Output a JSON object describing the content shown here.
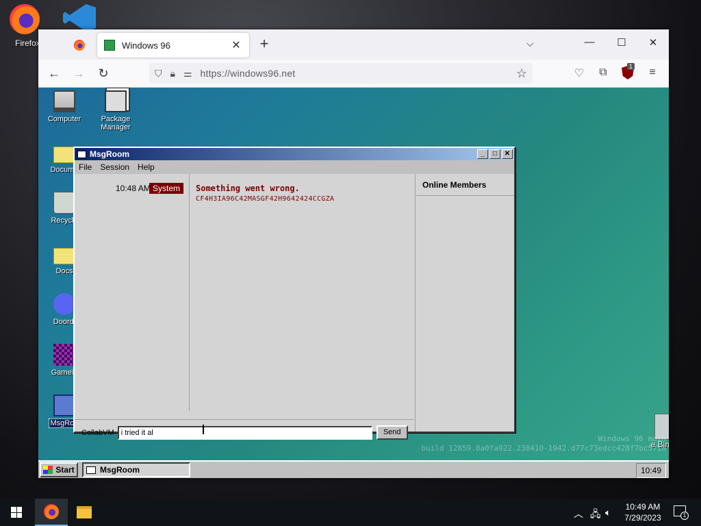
{
  "host_desktop": {
    "firefox_label": "Firefox"
  },
  "browser": {
    "tab_title": "Windows 96",
    "url": "https://windows96.net"
  },
  "win96": {
    "icons": {
      "computer": "Computer",
      "package_manager": "Package Manager",
      "documents": "Docume",
      "recycle": "Recycle",
      "docs": "Docs",
      "discord": "Doordi",
      "game": "Gamein",
      "msgroom": "MsgRoo"
    },
    "recycle_bin_right": "e Bin",
    "watermark_line1": "Windows 96 main",
    "watermark_line2": "build 12859.0a0fa922.230410-1942.d77c73edcc428f7bc5716",
    "taskbar": {
      "start": "Start",
      "item": "MsgRoom",
      "clock": "10:49"
    }
  },
  "msgroom": {
    "title": "MsgRoom",
    "menu": [
      "File",
      "Session",
      "Help"
    ],
    "message": {
      "time": "10:48 AM",
      "sender": "System",
      "title": "Something went wrong.",
      "code": "CF4H3IA96C42MASGF42H9642424CCGZA"
    },
    "members_header": "Online Members",
    "input": {
      "label": "CollabVM",
      "value": "i tried it al",
      "send": "Send"
    }
  },
  "win10": {
    "clock_time": "10:49 AM",
    "clock_date": "7/29/2023",
    "notification_count": "1"
  }
}
